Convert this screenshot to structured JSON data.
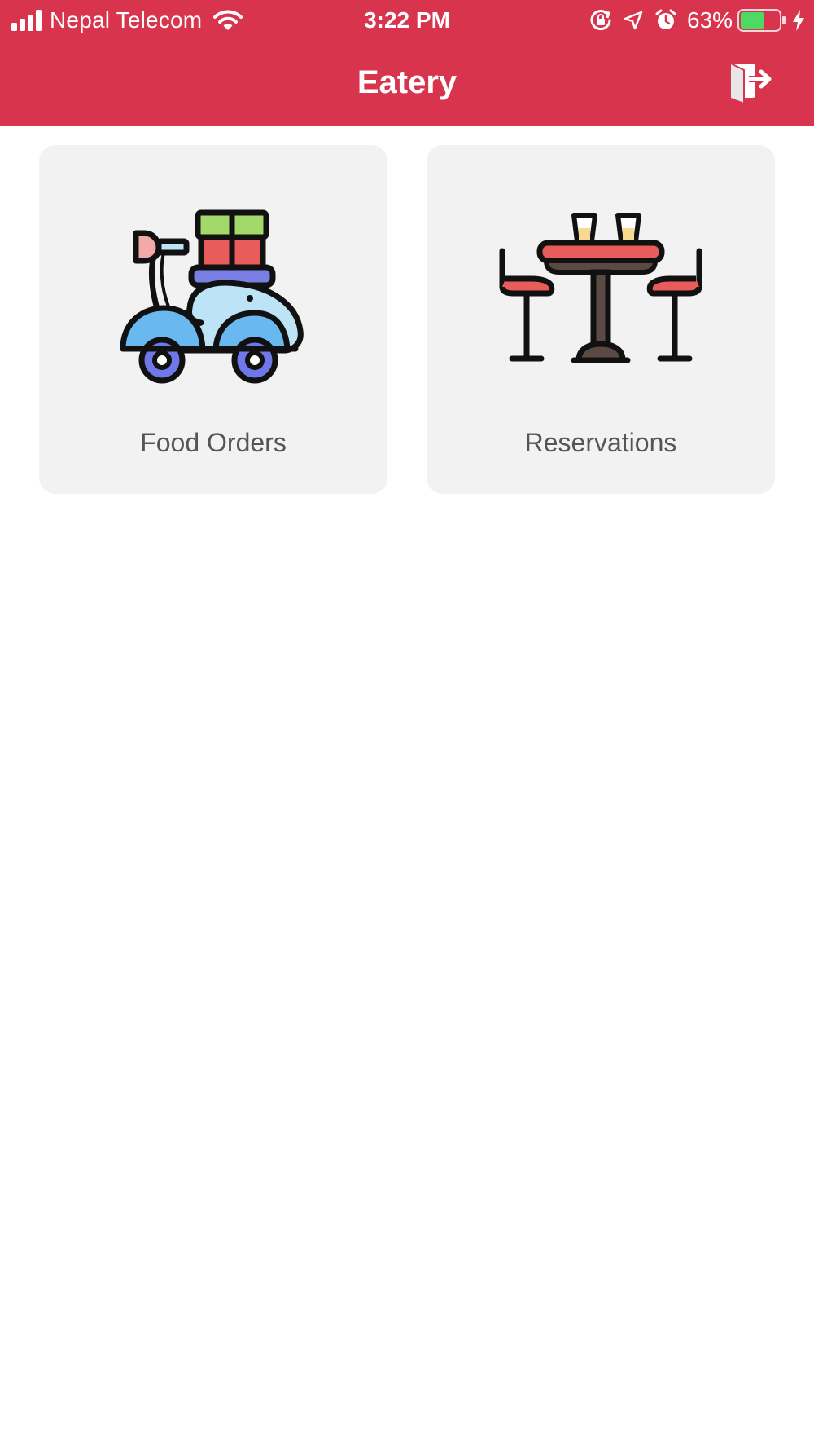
{
  "status_bar": {
    "carrier": "Nepal Telecom",
    "time": "3:22 PM",
    "battery_percent": "63%",
    "battery_level": 0.63,
    "icons": [
      "signal-icon",
      "wifi-icon",
      "rotation-lock-icon",
      "location-icon",
      "alarm-icon",
      "battery-icon",
      "charging-icon"
    ]
  },
  "nav": {
    "title": "Eatery",
    "logout_icon": "logout-icon"
  },
  "cards": [
    {
      "label": "Food Orders",
      "icon": "scooter-icon"
    },
    {
      "label": "Reservations",
      "icon": "dining-table-icon"
    }
  ],
  "colors": {
    "header": "#d9344e",
    "card_background": "#f2f2f2",
    "card_label": "#555555",
    "battery_fill": "#4cd964"
  }
}
